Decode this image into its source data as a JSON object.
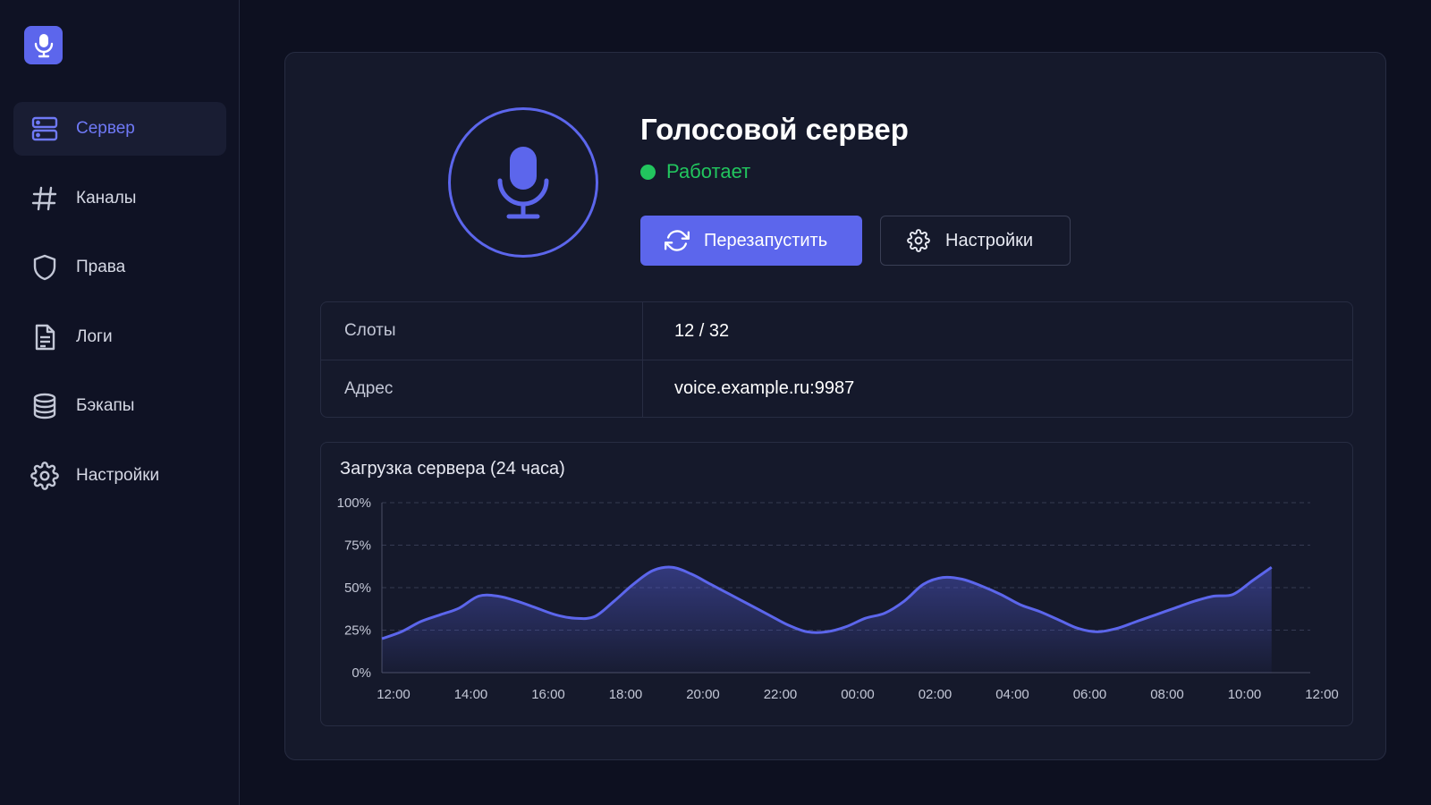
{
  "sidebar": {
    "logo_icon": "microphone-icon",
    "items": [
      {
        "label": "Сервер",
        "icon": "server-icon",
        "active": true
      },
      {
        "label": "Каналы",
        "icon": "hash-icon",
        "active": false
      },
      {
        "label": "Права",
        "icon": "shield-icon",
        "active": false
      },
      {
        "label": "Логи",
        "icon": "document-icon",
        "active": false
      },
      {
        "label": "Бэкапы",
        "icon": "database-icon",
        "active": false
      },
      {
        "label": "Настройки",
        "icon": "gear-icon",
        "active": false
      }
    ]
  },
  "server": {
    "title": "Голосовой сервер",
    "status": "Работает",
    "status_color": "#22c55e",
    "restart_label": "Перезапустить",
    "settings_label": "Настройки"
  },
  "info": {
    "rows": [
      {
        "key": "Слоты",
        "value": "12 / 32"
      },
      {
        "key": "Адрес",
        "value": "voice.example.ru:9987"
      }
    ]
  },
  "colors": {
    "accent": "#5c66ec",
    "background": "#0d1020",
    "panel": "#15192b"
  },
  "chart_data": {
    "type": "area",
    "title": "Загрузка сервера (24 часа)",
    "x": [
      "12:00",
      "14:00",
      "16:00",
      "18:00",
      "20:00",
      "22:00",
      "00:00",
      "02:00",
      "04:00",
      "06:00",
      "08:00",
      "10:00",
      "12:00"
    ],
    "series": [
      {
        "values": [
          20,
          24,
          30,
          34,
          38,
          45,
          45,
          42,
          38,
          34,
          32,
          33,
          42,
          52,
          60,
          62,
          58,
          52,
          46,
          40,
          34,
          28,
          24,
          24,
          27,
          32,
          35,
          42,
          52,
          56,
          55,
          51,
          46,
          40,
          36,
          31,
          26,
          24,
          26,
          30,
          34,
          38,
          42,
          45,
          46,
          54,
          62
        ]
      }
    ],
    "sample_step_hours": 0.5,
    "y_ticks": [
      "0%",
      "25%",
      "50%",
      "75%",
      "100%"
    ],
    "ylim": [
      0,
      100
    ],
    "grid": true,
    "line_color": "#5c66ec"
  }
}
